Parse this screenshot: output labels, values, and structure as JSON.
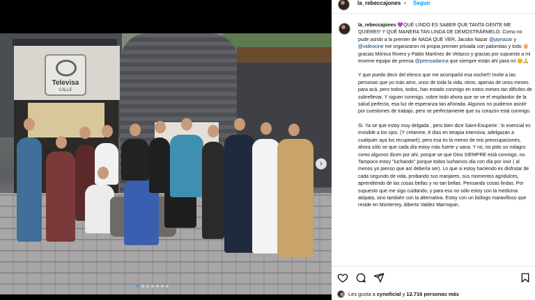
{
  "post": {
    "username": "la_rebeccajones",
    "verified": true,
    "follow_label": "Seguir",
    "separator": "•",
    "photo_sign": {
      "brand": "Televisa",
      "sub": "CALLE"
    },
    "carousel_next_icon": "chevron-right-icon",
    "carousel_dots": 7,
    "carousel_active": 0,
    "caption": {
      "username": "la_rebeccajones",
      "p1_a": " 💜QUÉ LINDO ES SABER QUE TANTA GENTE ME QUIERE!!! Y QUÉ MANERA TAN LINDA DE DEMOSTRÁRMELO. Como no pude asistir a la premier de NADA QUE VER, Jacobo Nazar ",
      "mention1": "@jaynazar",
      "p1_b": " y ",
      "mention2": "@videocine",
      "p1_c": " me organizaron mi propia premier privada con palomitas y todo 🍿gracias Mónica Rivero y Pablo Martínez de Velazco y gracias por supuesto a mi enorme equipo de prensa ",
      "mention3": "@prensadanna",
      "p1_d": " que siempre están ahí para mi 😊🙏",
      "p2": "Y que puedo decir del elenco que me acompañó esa noche!!! Invite a las personas que yo más amo, unos de toda la vida, otros, apenas de unos meses para acá, pero todos, todos, han estado conmigo en estos meses tan difíciles de sobrellevar, Y siguen conmigo, sobre todo ahora que se ve el resplandor de la salud perfecta, esa luz de esperanza tan añorada. Algunos no pudieron asistir por cuestiones de trabajo, pero se perfectamente que su corazón está conmigo.",
      "p3": "Si. Ya se que estoy muy delgada , pero bien dice Saint-Exuperie : lo esencial es invisible a los ojos. (Y créanme, 8 días en terapia intensiva, adelgazan a cualquier aya los recupearé), pero esa es la menor de mis preocupaciones, ahora sólo se que cada día estoy más fuerte y sana. Y no, no pido un milagro como algunos dicen por ahí, porque se que Dios SIEMPRE está conmigo, no. Tampoco estoy \"luchando\" porque todos luchamos día con día por vivir ( al menos yo pienso que así debería ser). Lo que si estoy haciendo es disfrutar de cada segundo de vida, probando sus manjares, sus momentos agridulces, aprendiendo de las cosas bellas y no tan bellas. Pensando cosas lindas. Por supuesto que me sigo cuidando, y para eso no sólo estoy con la medicina alópata, sino también con la alternativa. Estoy con un biólogo maravilloso que reside en Monterrey, Alberto Valdez Marroquin."
    },
    "actions": {
      "like_icon": "heart-icon",
      "comment_icon": "comment-icon",
      "share_icon": "share-icon",
      "save_icon": "bookmark-icon"
    },
    "likes": {
      "prefix": "Les gusta a ",
      "user": "cynoficial",
      "middle": " y ",
      "count": "12.716 personas más"
    }
  }
}
